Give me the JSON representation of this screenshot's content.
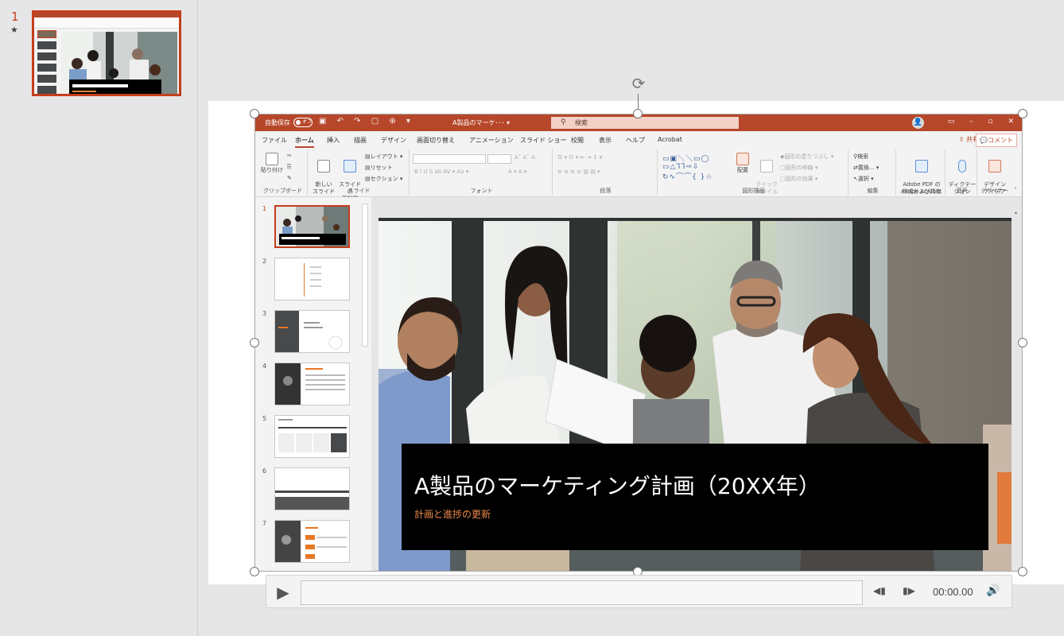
{
  "outer": {
    "slide_number": "1",
    "star": "★"
  },
  "video": {
    "titlebar": {
      "autosave": "自動保存",
      "toggle": "オフ",
      "doc_title": "A製品のマーケ･･･ ▾",
      "search_placeholder": "検索"
    },
    "tabs": [
      "ファイル",
      "ホーム",
      "挿入",
      "描画",
      "デザイン",
      "画面切り替え",
      "アニメーション",
      "スライド ショー",
      "校閲",
      "表示",
      "ヘルプ",
      "Acrobat"
    ],
    "active_tab": "ホーム",
    "share": "共有",
    "comment": "コメント",
    "ribbon": {
      "paste": "貼り付け",
      "clipboard": "クリップボード",
      "new_slide": "新しい\nスライド",
      "reuse_slide": "スライドの\n再利用",
      "layout": "レイアウト",
      "reset": "リセット",
      "section": "セクション",
      "slides": "スライド",
      "font": "フォント",
      "paragraph": "段落",
      "arrange": "配置",
      "quick_style": "クイック\nスタイル",
      "shape_fill": "図形の塗りつぶし",
      "shape_outline": "図形の枠線",
      "shape_effect": "図形の効果",
      "drawing": "図形描画",
      "find": "検索",
      "replace": "置換...",
      "select": "選択",
      "editing": "編集",
      "adobe_pdf": "Adobe PDF の\n作成および共有",
      "adobe_acrobat": "Adobe Acrobat",
      "dictate": "ディクテー\nション",
      "voice": "音声",
      "design_ideas": "デザイン\nアイデア",
      "designer": "デザイナー"
    },
    "thumbnails": [
      "1",
      "2",
      "3",
      "4",
      "5",
      "6",
      "7"
    ],
    "slide": {
      "title": "A製品のマーケティング計画（20XX年）",
      "subtitle": "計画と進捗の更新"
    }
  },
  "media": {
    "time": "00:00.00"
  },
  "colors": {
    "accent": "#c43e1c",
    "ppt_red": "#b7472a",
    "orange": "#e87722"
  }
}
